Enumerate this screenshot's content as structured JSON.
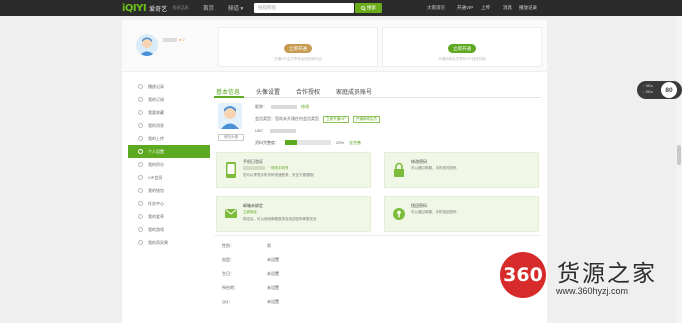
{
  "topbar": {
    "logo_mark": "iQIYI",
    "logo_name": "爱奇艺",
    "logo_tag": "· 悦享品质",
    "nav_home": "首页",
    "nav_channel": "频道 ▾",
    "search_placeholder": "搜狐网盘",
    "search_button": "搜索",
    "right_items": [
      "大雨滂沱",
      "开通VIP",
      "上传",
      "消息",
      "播放记录"
    ]
  },
  "profile": {
    "username_blur": "",
    "level": "● 2"
  },
  "vip_cards": [
    {
      "button": "立即开通",
      "desc": "开通VIP会员享有全网独家内容",
      "color": "#c79b52"
    },
    {
      "button": "立即开通",
      "desc": "开通网球会员享有VIP独家特权",
      "color": "#5ea922"
    }
  ],
  "sidebar": {
    "items": [
      {
        "label": "播放记录"
      },
      {
        "label": "我的订阅"
      },
      {
        "label": "我要收藏"
      },
      {
        "label": "我的消息"
      },
      {
        "label": "我的上传"
      },
      {
        "label": "个人设置",
        "active": true
      },
      {
        "label": "我的积分"
      },
      {
        "label": "VIP会员"
      },
      {
        "label": "我的钱包"
      },
      {
        "label": "任务中心"
      },
      {
        "label": "我的爱草"
      },
      {
        "label": "我的游戏"
      },
      {
        "label": "我的奇异果"
      }
    ]
  },
  "tabs": [
    {
      "label": "基本信息",
      "active": true
    },
    {
      "label": "头像设置"
    },
    {
      "label": "合作授权"
    },
    {
      "label": "家庭成员账号"
    }
  ],
  "basic": {
    "avatar_caption": "修改头像",
    "nickname_label": "昵称：",
    "nickname_tag": "修改",
    "member_label": "会员类型：您尚未开通任何会员类型",
    "member_pill1": "立即开通VIP",
    "member_pill2": "开通网球会员",
    "uid_label": "UID：",
    "progress_label": "资料完整度：",
    "progress_value": 25,
    "progress_text": "25%",
    "progress_link": "去完善"
  },
  "security_cards": [
    {
      "title": "手机已验证",
      "extra": "· 修改手机号",
      "desc": "您可以享受手机号码快速登录，安全又便捷哦！",
      "icon": "phone-icon"
    },
    {
      "title": "修改密码",
      "extra": "",
      "desc": "可以通过邮箱、手机修改密码",
      "icon": "lock-icon"
    },
    {
      "title": "邮箱未绑定",
      "extra": "立即绑定",
      "desc": "绑定后，可以使用邮箱登录及找回密码等更安全",
      "icon": "mail-icon"
    },
    {
      "title": "找回密码",
      "extra": "",
      "desc": "可以通过邮箱、手机找回密码",
      "icon": "key-icon"
    }
  ],
  "form_rows": [
    {
      "label": "性别：",
      "value": "男"
    },
    {
      "label": "血型：",
      "value": "未设置"
    },
    {
      "label": "生日：",
      "value": "未设置"
    },
    {
      "label": "所在地：",
      "value": "未设置"
    },
    {
      "label": "QQ：",
      "value": "未设置"
    }
  ],
  "speed_widget": {
    "line1": "↑ 0K/s",
    "line2": "↓ 0K/s",
    "value": "80"
  },
  "watermark": {
    "badge": "360",
    "name": "货源之家",
    "url": "www.360hyzj.com"
  }
}
